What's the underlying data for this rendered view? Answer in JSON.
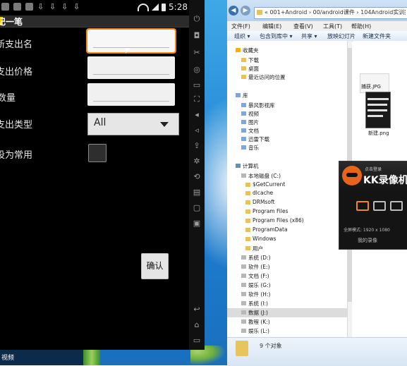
{
  "emulator": {
    "status": {
      "time": "5:28"
    },
    "title": "记一笔",
    "form": {
      "name_label": "新支出名",
      "price_label": "支出价格",
      "qty_label": "数量",
      "type_label": "支出类型",
      "type_value": "All",
      "common_label": "设为常用",
      "confirm_label": "确认"
    }
  },
  "explorer": {
    "address": "« 001+Android › 00/android课件 › 104Android实训案例",
    "menu": [
      "文件(F)",
      "编辑(E)",
      "查看(V)",
      "工具(T)",
      "帮助(H)"
    ],
    "commands": [
      "组织 ▾",
      "包含到库中 ▾",
      "共享 ▾",
      "放映幻灯片",
      "新建文件夹"
    ],
    "nav": {
      "favorites": "收藏夹",
      "downloads": "下载",
      "desktop": "桌面",
      "recent": "最近访问的位置",
      "libraries": "库",
      "storm": "暴风影视库",
      "videos": "视频",
      "pictures": "图片",
      "documents": "文档",
      "thunder": "迅雷下载",
      "music": "音乐",
      "computer": "计算机",
      "local_c": "本地磁盘 (C:)",
      "getcurrent": "$GetCurrent",
      "dlcache": "dlcache",
      "drmsoft": "DRMsoft",
      "program_files": "Program Files",
      "program_files_x86": "Program Files (x86)",
      "programdata": "ProgramData",
      "windows": "Windows",
      "users": "用户",
      "sys_d": "系统 (D:)",
      "soft_e": "软件 (E:)",
      "doc_f": "文档 (F:)",
      "media_g": "娱乐 (G:)",
      "soft_h": "软件 (H:)",
      "sys_i": "系统 (I:)",
      "data_j": "数据 (J:)",
      "misc_k": "教程 (K:)",
      "ent_l": "娱乐 (L:)"
    },
    "files": {
      "jpg_name": "捕获.JPG",
      "png_name": "新建.png"
    },
    "detail": "9 个对象"
  },
  "kk": {
    "small": "点击登录",
    "title": "KK录像机",
    "resolution": "全屏模式: 1920 x 1080",
    "settings": "我的录像"
  },
  "taskbar": {
    "label": "视频"
  }
}
